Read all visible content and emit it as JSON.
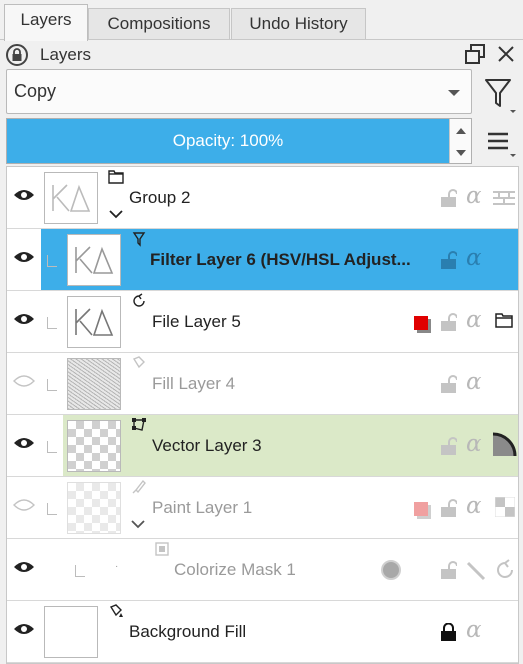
{
  "tabs": [
    "Layers",
    "Compositions",
    "Undo History"
  ],
  "docker": {
    "title": "Layers"
  },
  "blend_mode": {
    "value": "Copy"
  },
  "opacity": {
    "label": "Opacity: 100%",
    "value_percent": 100
  },
  "icons": {
    "float": "float-icon",
    "close": "close-icon",
    "filter": "filter-icon",
    "menu": "hamburger-menu-icon",
    "eye": "eye-icon",
    "lock": "padlock-icon",
    "alpha": "alpha-lock-icon"
  },
  "colors": {
    "accent": "#3daee9",
    "vector_row": "#dbe9c8",
    "label_red": "#e00000"
  },
  "layers": [
    {
      "name": "Group 2"
    },
    {
      "name": "Filter Layer 6 (HSV/HSL Adjust..."
    },
    {
      "name": "File Layer 5"
    },
    {
      "name": "Fill Layer 4"
    },
    {
      "name": "Vector Layer 3"
    },
    {
      "name": "Paint Layer 1"
    },
    {
      "name": "Colorize Mask 1"
    },
    {
      "name": "Background Fill"
    }
  ],
  "alpha_glyph": "α"
}
